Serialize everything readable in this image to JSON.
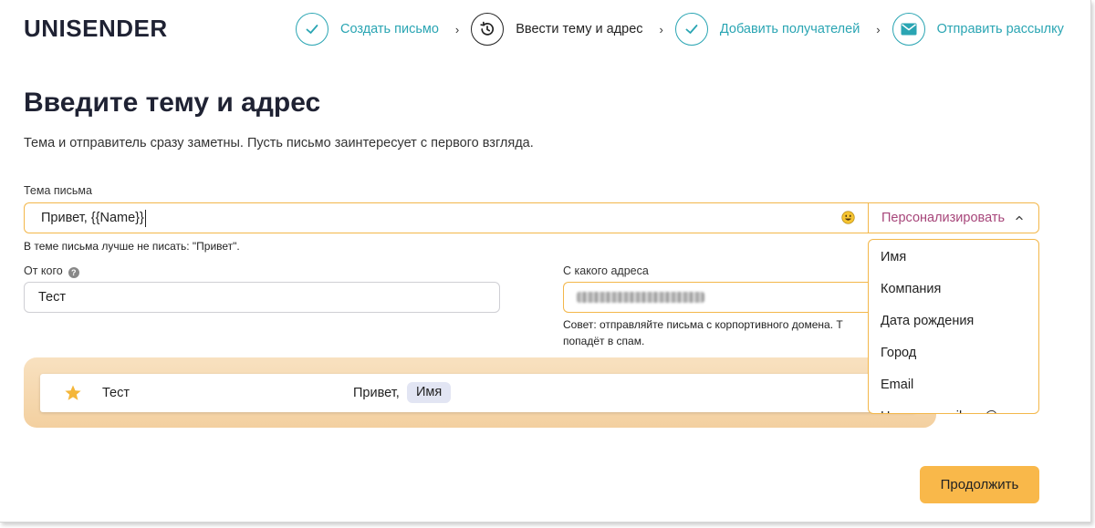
{
  "app": {
    "logo": "UNISENDER"
  },
  "steps": [
    {
      "label": "Создать письмо",
      "state": "done",
      "icon": "check-icon"
    },
    {
      "label": "Ввести тему и адрес",
      "state": "current",
      "icon": "history-icon"
    },
    {
      "label": "Добавить получателей",
      "state": "done",
      "icon": "check-icon"
    },
    {
      "label": "Отправить рассылку",
      "state": "pending",
      "icon": "envelope-icon"
    }
  ],
  "page": {
    "title": "Введите тему и адрес",
    "subtitle": "Тема и отправитель сразу заметны. Пусть письмо заинтересует с первого взгляда."
  },
  "subject": {
    "label": "Тема письма",
    "value": "Привет, {{Name}}",
    "hint": "В теме письма лучше не писать: \"Привет\".",
    "personalize_label": "Персонализировать"
  },
  "personalize_menu": {
    "items": [
      "Имя",
      "Компания",
      "Дата рождения",
      "Город",
      "Email",
      "Начало email до @"
    ]
  },
  "sender": {
    "label": "От кого",
    "value": "Тест"
  },
  "address": {
    "label": "С какого адреса",
    "tip_line1": "Совет: отправляйте письма с корпортивного домена. Т",
    "tip_line2": "попадёт в спам."
  },
  "preview": {
    "from": "Тест",
    "subject_text": "Привет,",
    "tag": "Имя"
  },
  "actions": {
    "continue_label": "Продолжить"
  },
  "colors": {
    "accent_teal": "#2aa5b3",
    "focus_orange": "#f3b74a",
    "personalize_text": "#a7467a",
    "continue_button": "#f9b84a"
  }
}
